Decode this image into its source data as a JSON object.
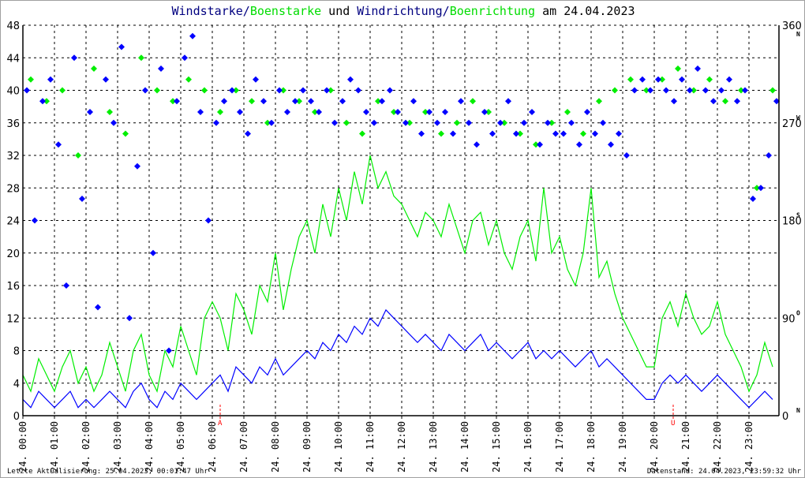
{
  "chart_data": {
    "type": "line",
    "title_parts": [
      "Windstarke",
      "/",
      "Boenstarke",
      " und ",
      "Windrichtung",
      "/",
      "Boenrichtung",
      " am 24.04.2023"
    ],
    "date_prefix": "24.",
    "x_ticks": [
      "00:00",
      "01:00",
      "02:00",
      "03:00",
      "04:00",
      "05:00",
      "06:00",
      "07:00",
      "08:00",
      "09:00",
      "10:00",
      "11:00",
      "12:00",
      "13:00",
      "14:00",
      "15:00",
      "16:00",
      "17:00",
      "18:00",
      "19:00",
      "20:00",
      "21:00",
      "22:00",
      "23:00"
    ],
    "y_left": {
      "range": [
        0,
        48
      ],
      "ticks": [
        "0",
        "4",
        "8",
        "12",
        "16",
        "20",
        "24",
        "28",
        "32",
        "36",
        "40",
        "44",
        "48"
      ]
    },
    "y_right": {
      "range": [
        0,
        360
      ],
      "ticks": [
        "0",
        "90",
        "180",
        "270",
        "360"
      ],
      "compass": [
        "N",
        "O",
        "S",
        "W",
        "N"
      ]
    },
    "grid": true,
    "markers": [
      {
        "label": "A",
        "hour": 6.25
      },
      {
        "label": "U",
        "hour": 20.6
      }
    ],
    "sample_interval_minutes": 15,
    "series": [
      {
        "name": "Windstarke",
        "color": "#0000ff",
        "values": [
          2,
          1,
          3,
          2,
          1,
          2,
          3,
          1,
          2,
          1,
          2,
          3,
          2,
          1,
          3,
          4,
          2,
          1,
          3,
          2,
          4,
          3,
          2,
          3,
          4,
          5,
          3,
          6,
          5,
          4,
          6,
          5,
          7,
          5,
          6,
          7,
          8,
          7,
          9,
          8,
          10,
          9,
          11,
          10,
          12,
          11,
          13,
          12,
          11,
          10,
          9,
          10,
          9,
          8,
          10,
          9,
          8,
          9,
          10,
          8,
          9,
          8,
          7,
          8,
          9,
          7,
          8,
          7,
          8,
          7,
          6,
          7,
          8,
          6,
          7,
          6,
          5,
          4,
          3,
          2,
          2,
          4,
          5,
          4,
          5,
          4,
          3,
          4,
          5,
          4,
          3,
          2,
          1,
          2,
          3,
          2
        ]
      },
      {
        "name": "Boenstarke",
        "color": "#00ee00",
        "values": [
          5,
          3,
          7,
          5,
          3,
          6,
          8,
          4,
          6,
          3,
          5,
          9,
          6,
          3,
          8,
          10,
          5,
          3,
          8,
          6,
          11,
          8,
          5,
          12,
          14,
          12,
          8,
          15,
          13,
          10,
          16,
          14,
          20,
          13,
          18,
          22,
          24,
          20,
          26,
          22,
          28,
          24,
          30,
          26,
          32,
          28,
          30,
          27,
          26,
          24,
          22,
          25,
          24,
          22,
          26,
          23,
          20,
          24,
          25,
          21,
          24,
          20,
          18,
          22,
          24,
          19,
          28,
          20,
          22,
          18,
          16,
          20,
          28,
          17,
          19,
          15,
          12,
          10,
          8,
          6,
          6,
          12,
          14,
          11,
          15,
          12,
          10,
          11,
          14,
          10,
          8,
          6,
          3,
          5,
          9,
          6
        ]
      },
      {
        "name": "Windrichtung",
        "color": "#0000ff",
        "unit": "deg",
        "values": [
          300,
          180,
          290,
          310,
          250,
          120,
          330,
          200,
          280,
          100,
          310,
          270,
          340,
          90,
          230,
          300,
          150,
          320,
          60,
          290,
          330,
          350,
          280,
          180,
          270,
          290,
          300,
          280,
          260,
          310,
          290,
          270,
          300,
          280,
          290,
          300,
          290,
          280,
          300,
          270,
          290,
          310,
          300,
          280,
          270,
          290,
          300,
          280,
          270,
          290,
          260,
          280,
          270,
          280,
          260,
          290,
          270,
          250,
          280,
          260,
          270,
          290,
          260,
          270,
          280,
          250,
          270,
          260,
          260,
          270,
          250,
          280,
          260,
          270,
          250,
          260,
          240,
          300,
          310,
          300,
          310,
          300,
          290,
          310,
          300,
          320,
          300,
          290,
          300,
          310,
          290,
          300,
          200,
          210,
          240,
          290
        ]
      },
      {
        "name": "Boenrichtung",
        "color": "#00ee00",
        "unit": "deg",
        "sample_interval_minutes": 30,
        "values": [
          310,
          290,
          300,
          240,
          320,
          280,
          260,
          330,
          300,
          290,
          310,
          300,
          280,
          300,
          290,
          270,
          300,
          290,
          280,
          300,
          270,
          260,
          290,
          280,
          270,
          280,
          260,
          270,
          290,
          280,
          270,
          260,
          250,
          270,
          280,
          260,
          290,
          300,
          310,
          300,
          310,
          320,
          300,
          310,
          290,
          300,
          210,
          300
        ]
      }
    ]
  },
  "footer": {
    "last_update": "Letzte Aktualisierung: 25.04.2023, 00:01:47 Uhr",
    "data_state": "Datenstand: 24.04.2023, 23:59:32 Uhr"
  }
}
